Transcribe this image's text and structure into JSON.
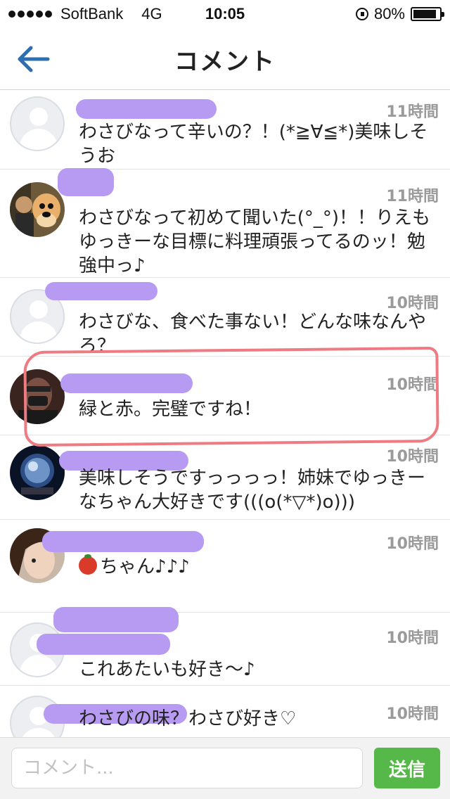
{
  "status_bar": {
    "carrier": "SoftBank",
    "network": "4G",
    "time": "10:05",
    "battery": "80%",
    "battery_level": 0.8
  },
  "header": {
    "title": "コメント",
    "back_icon": "arrow-left-icon"
  },
  "comments": [
    {
      "user": "",
      "time": "11時間",
      "text": "わさびなって辛いの？！(*≧∀≦*)美味しそうお",
      "avatar": "default"
    },
    {
      "user": "",
      "time": "11時間",
      "text": "わさびなって初めて聞いた(°_°)！！りえもゆっきーな目標に料理頑張ってるのッ！勉強中っ♪",
      "avatar": "photo-cartoon"
    },
    {
      "user": "",
      "time": "10時間",
      "text": "わさびな、食べた事ない！どんな味なんやろ？",
      "avatar": "default"
    },
    {
      "user": "",
      "time": "10時間",
      "text": "緑と赤。完璧ですね！",
      "avatar": "photo-dark",
      "highlighted": true
    },
    {
      "user": "",
      "time": "10時間",
      "text": "美味しそうですっっっっ！姉妹でゆっきーなちゃん大好きです(((o(*▽*)o)))",
      "avatar": "photo-globe"
    },
    {
      "user": "",
      "time": "10時間",
      "text": "ちゃん♪♪♪",
      "avatar": "photo-girl",
      "emoji": "tomato-icon"
    },
    {
      "user": "",
      "time": "10時間",
      "text": "これあたいも好き〜♪",
      "avatar": "default"
    },
    {
      "user": "",
      "time": "10時間",
      "text": "わさびの味？わさび好き♡",
      "avatar": "default"
    }
  ],
  "composer": {
    "placeholder": "コメント...",
    "send_label": "送信"
  },
  "colors": {
    "accent_blue": "#2f6fb0",
    "send_green": "#57b84a",
    "redaction_purple": "#b79bf2",
    "highlight_red": "#ee7b82"
  }
}
